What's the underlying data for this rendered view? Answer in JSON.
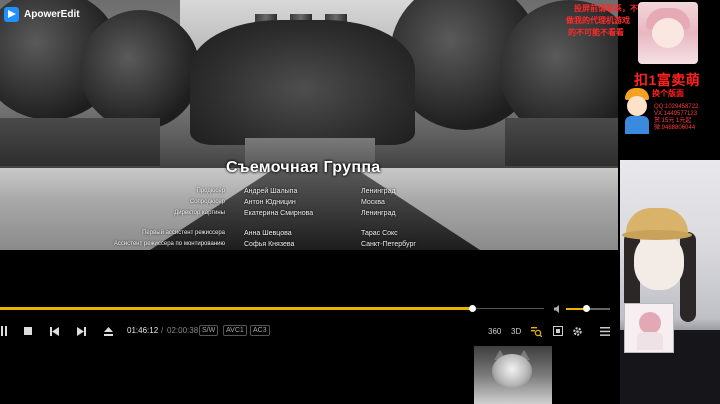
{
  "app": {
    "name": "ApowerEdit"
  },
  "video": {
    "credits_title": "Съемочная Группа",
    "credits": [
      {
        "role": "Продюсер",
        "name": "Андрей Шалыпа",
        "city": "Ленинград"
      },
      {
        "role": "Сопродюсер",
        "name": "Антон Юдницин",
        "city": "Москва"
      },
      {
        "role": "Директор картины",
        "name": "Екатерина Смирнова",
        "city": "Ленинград"
      },
      {
        "role": "Первый ассистент режиссера",
        "name": "Анна Шевцова",
        "city": "Тарас Сокс"
      },
      {
        "role": "Ассистент режиссера по монтированию",
        "name": "Софья Князева",
        "city": "Санкт-Петербург"
      }
    ]
  },
  "player": {
    "progress_fraction": 0.87,
    "volume_fraction": 0.45,
    "time_current": "01:46:12",
    "time_separator": "/",
    "time_total": "02:00:38",
    "tags": [
      "S/W",
      "AVC1",
      "AC3"
    ],
    "icons": {
      "pause": "pause-icon",
      "stop": "stop-icon",
      "prev": "previous-icon",
      "next": "next-icon",
      "eject": "eject-icon",
      "three_sixty": "360-icon",
      "three_d": "3d-icon",
      "search": "search-icon",
      "capture": "capture-icon",
      "settings": "gear-icon",
      "menu": "menu-icon",
      "volume": "volume-icon"
    },
    "labels": {
      "three_sixty": "360",
      "three_d": "3D"
    }
  },
  "overlay": {
    "red_text_lines": [
      "投屏前请联系，不关注",
      "做我的代理机游戏",
      "的不可能不看看"
    ],
    "promo_title": "扣1富卖萌",
    "promo_sub": "换个版面",
    "promo_lines": [
      "QQ:1029458722",
      "VX:1449577123",
      "赏:15元  1元起",
      "微:9488806044"
    ]
  },
  "colors": {
    "accent": "#e8b400",
    "promo_red": "#ff2020",
    "app_blue": "#1e90ff"
  }
}
